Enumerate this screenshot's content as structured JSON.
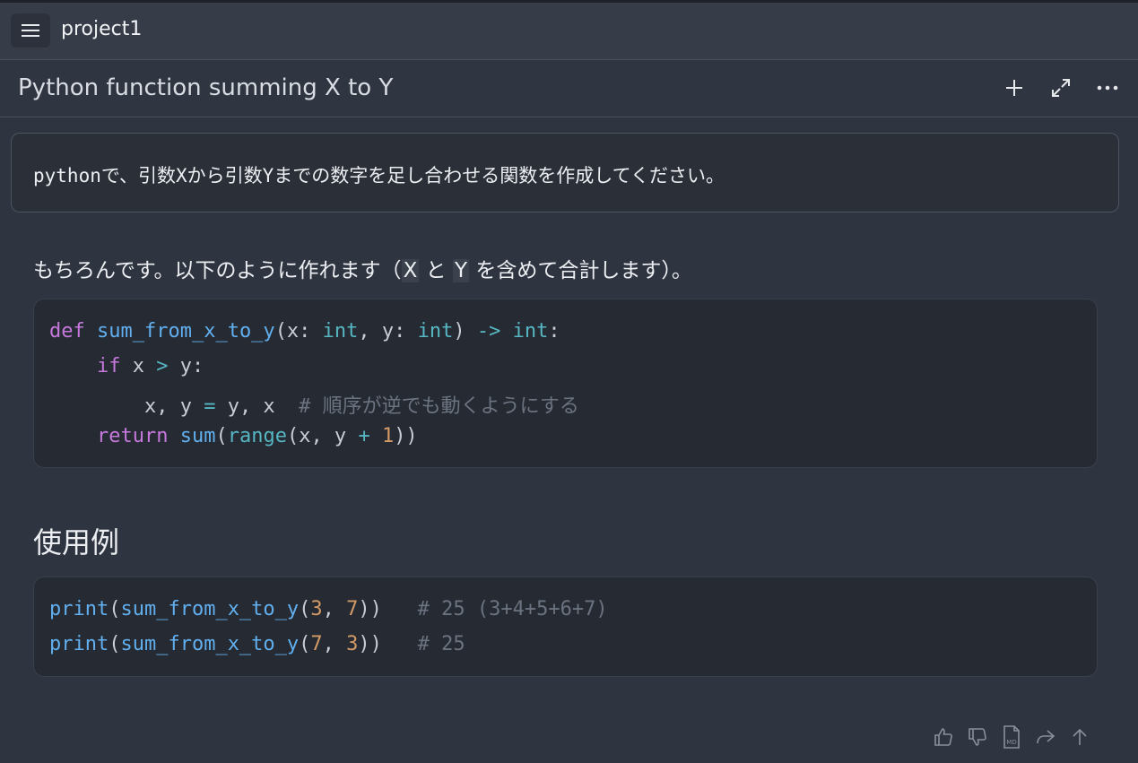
{
  "header": {
    "project_name": "project1"
  },
  "chat": {
    "title": "Python function summing X to Y",
    "user_message": "pythonで、引数Xから引数Yまでの数字を足し合わせる関数を作成してください。",
    "assistant_intro": {
      "part1": "もちろんです。以下のように作れます（",
      "code_x": "X",
      "and": " と ",
      "code_y": "Y",
      "part2": " を含めて合計します）。"
    },
    "section_heading": "使用例",
    "code_block_1": {
      "l1": {
        "def": "def",
        "name": "sum_from_x_to_y",
        "p1": "(x: ",
        "int1": "int",
        "p2": ", y: ",
        "int2": "int",
        "p3": ") ",
        "arrow": "->",
        "p4": " ",
        "int3": "int",
        "p5": ":"
      },
      "l2": {
        "indent": "    ",
        "if": "if",
        "p1": " x ",
        "gt": ">",
        "p2": " y:"
      },
      "l3": {
        "indent": "        ",
        "p1": "x, y ",
        "eq": "=",
        "p2": " y, x  ",
        "comment": "# 順序が逆でも動くようにする"
      },
      "l4": {
        "indent": "    ",
        "ret": "return",
        "sp": " ",
        "sum": "sum",
        "p1": "(",
        "range": "range",
        "p2": "(x, y ",
        "plus": "+",
        "sp2": " ",
        "one": "1",
        "p3": "))"
      }
    },
    "code_block_2": {
      "l1": {
        "print": "print",
        "p1": "(",
        "name": "sum_from_x_to_y",
        "p2": "(",
        "a": "3",
        "comma": ", ",
        "b": "7",
        "p3": "))   ",
        "comment": "# 25 (3+4+5+6+7)"
      },
      "l2": {
        "print": "print",
        "p1": "(",
        "name": "sum_from_x_to_y",
        "p2": "(",
        "a": "7",
        "comma": ", ",
        "b": "3",
        "p3": "))   ",
        "comment": "# 25"
      }
    }
  },
  "colors": {
    "background": "#2e3440",
    "code_bg": "#262b33",
    "keyword": "#c678dd",
    "function": "#61afef",
    "number": "#d19a66",
    "comment": "#6b7380"
  },
  "icons": {
    "menu": "hamburger-menu-icon",
    "new": "plus-icon",
    "expand": "expand-icon",
    "more": "more-horizontal-icon",
    "actions": [
      "thumbs-up-icon",
      "thumbs-down-icon",
      "markdown-icon",
      "share-icon",
      "scroll-up-icon"
    ]
  }
}
